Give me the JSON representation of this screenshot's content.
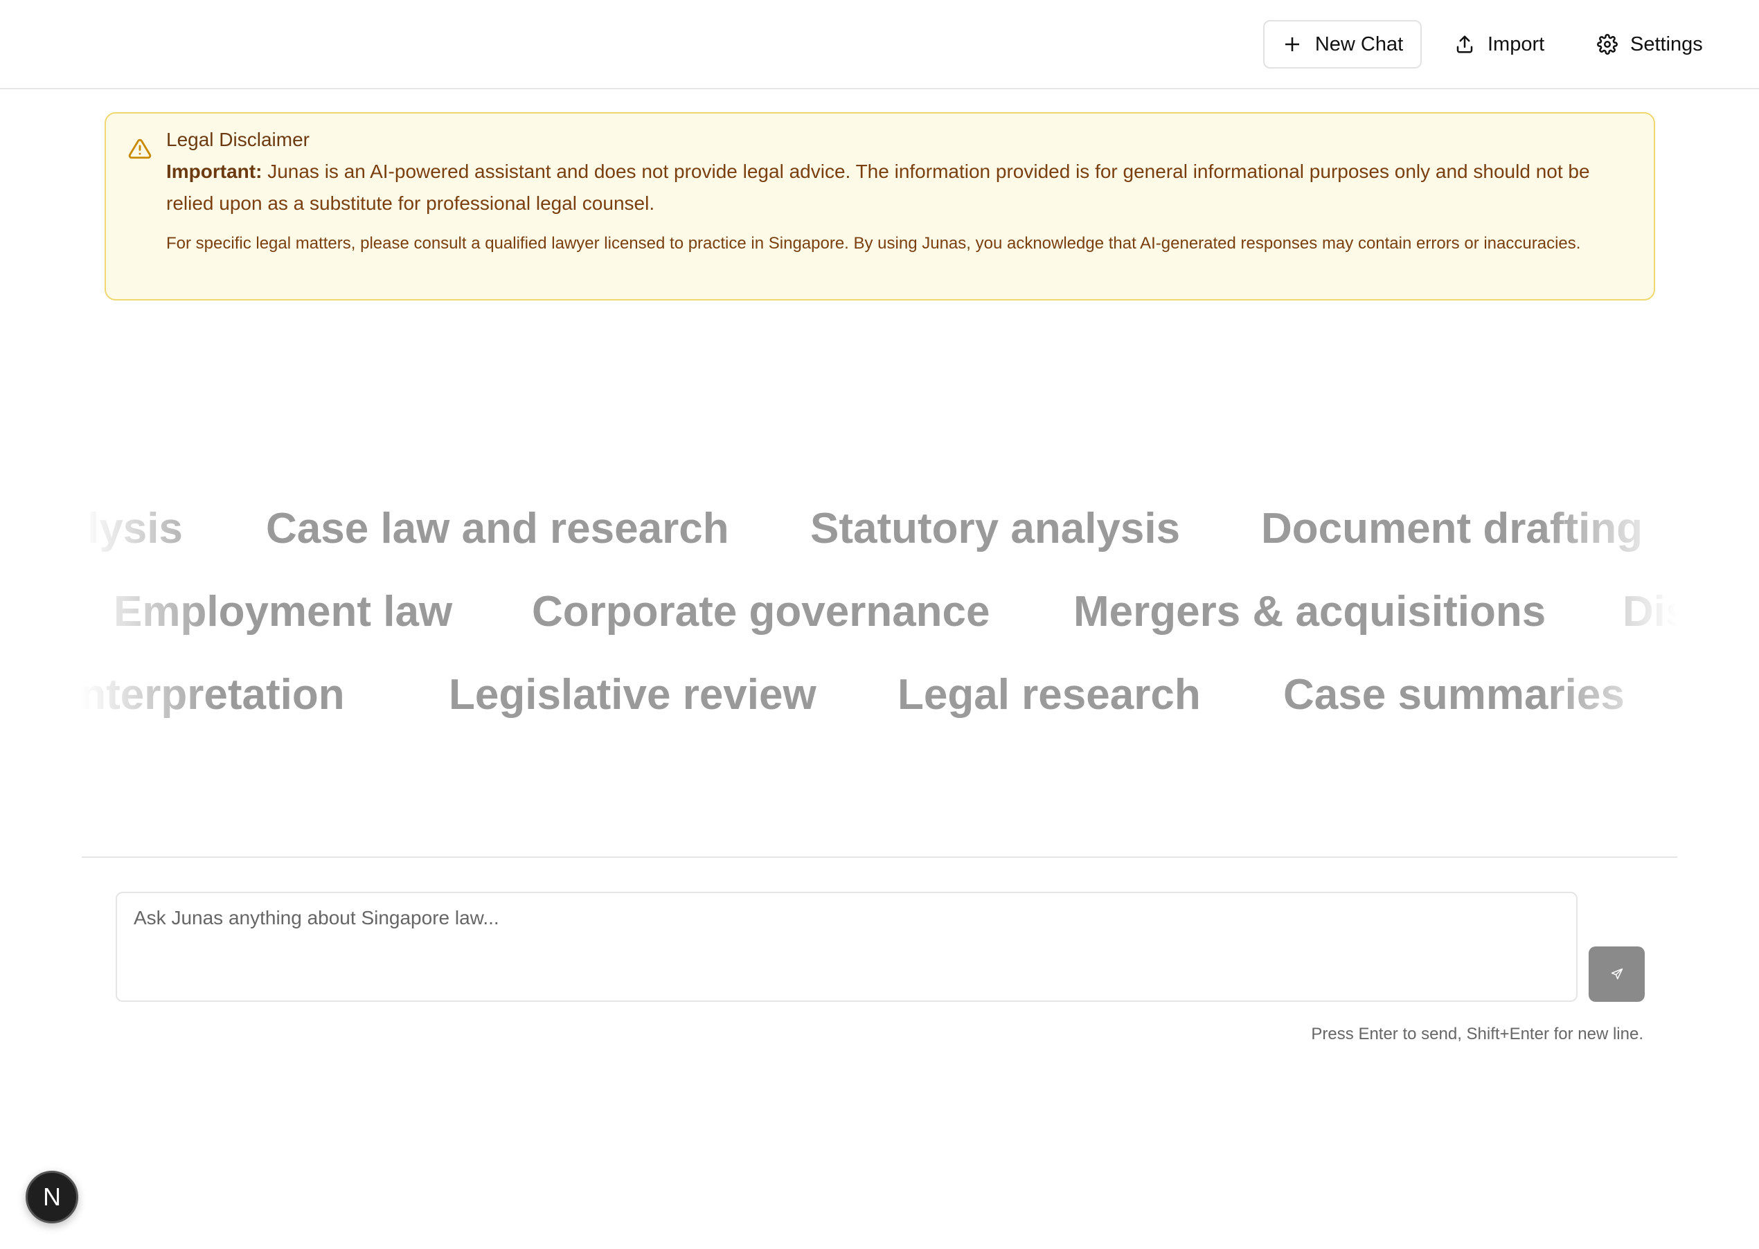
{
  "header": {
    "new_chat": "New Chat",
    "import": "Import",
    "settings": "Settings"
  },
  "disclaimer": {
    "title": "Legal Disclaimer",
    "important_label": "Important:",
    "body": " Junas is an AI-powered assistant and does not provide legal advice. The information provided is for general informational purposes only and should not be relied upon as a substitute for professional legal counsel.",
    "note": "For specific legal matters, please consult a qualified lawyer licensed to practice in Singapore. By using Junas, you acknowledge that AI-generated responses may contain errors or inaccuracies."
  },
  "topics": {
    "row1": [
      "lysis",
      "Case law and research",
      "Statutory analysis",
      "Document drafting"
    ],
    "row2": [
      "Employment law",
      "Corporate governance",
      "Mergers & acquisitions",
      "Dis"
    ],
    "row3": [
      "interpretation",
      "Legislative review",
      "Legal research",
      "Case summaries"
    ]
  },
  "composer": {
    "placeholder": "Ask Junas anything about Singapore law...",
    "hint": "Press Enter to send, Shift+Enter for new line."
  },
  "badge": {
    "letter": "N"
  },
  "colors": {
    "disclaimer_bg": "#fefae8",
    "disclaimer_border": "#f0d870",
    "disclaimer_text": "#7a3f0f",
    "send_button": "#8a8a8a"
  }
}
